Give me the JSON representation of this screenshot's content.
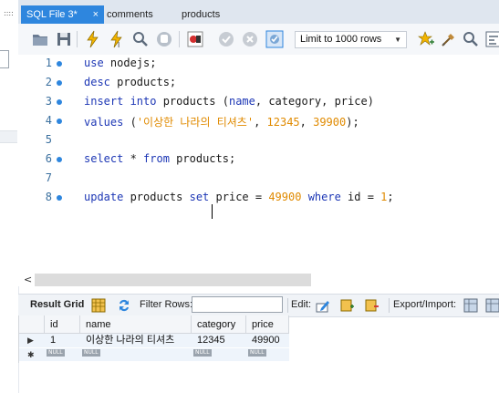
{
  "tabs": [
    {
      "label": "SQL File 3*",
      "close": "×",
      "active": true
    },
    {
      "label": "comments",
      "active": false
    },
    {
      "label": "products",
      "active": false
    }
  ],
  "left_panel": {
    "dots": "::::"
  },
  "toolbar": {
    "buttons": [
      "open-folder-icon",
      "save-icon",
      "execute-icon",
      "execute-current-icon",
      "explain-icon",
      "stop-icon",
      "toggle-icon",
      "commit-icon",
      "rollback-icon",
      "autocommit-icon",
      "bookmark-icon",
      "beautify-icon",
      "find-icon",
      "wrap-icon"
    ],
    "limit": {
      "selected": "Limit to 1000 rows",
      "caret": "▼"
    }
  },
  "editor": {
    "lines": [
      {
        "num": "1",
        "tokens": [
          {
            "t": "kw",
            "s": "use"
          },
          {
            "t": "pl",
            "s": " nodejs;"
          }
        ]
      },
      {
        "num": "2",
        "tokens": [
          {
            "t": "kw",
            "s": "desc"
          },
          {
            "t": "pl",
            "s": " products;"
          }
        ]
      },
      {
        "num": "3",
        "tokens": [
          {
            "t": "kw",
            "s": "insert into"
          },
          {
            "t": "pl",
            "s": " products ("
          },
          {
            "t": "kw",
            "s": "name"
          },
          {
            "t": "pl",
            "s": ", category, price)"
          }
        ]
      },
      {
        "num": "4",
        "tokens": [
          {
            "t": "kw",
            "s": "values"
          },
          {
            "t": "pl",
            "s": " ("
          },
          {
            "t": "str",
            "s": "'이상한 나라의 티셔츠'"
          },
          {
            "t": "pl",
            "s": ", "
          },
          {
            "t": "num",
            "s": "12345"
          },
          {
            "t": "pl",
            "s": ", "
          },
          {
            "t": "num",
            "s": "39900"
          },
          {
            "t": "pl",
            "s": ");"
          }
        ]
      },
      {
        "num": "5",
        "tokens": []
      },
      {
        "num": "6",
        "tokens": [
          {
            "t": "kw",
            "s": "select"
          },
          {
            "t": "pl",
            "s": " * "
          },
          {
            "t": "kw",
            "s": "from"
          },
          {
            "t": "pl",
            "s": " products;"
          }
        ]
      },
      {
        "num": "7",
        "tokens": []
      },
      {
        "num": "8",
        "tokens": [
          {
            "t": "kw",
            "s": "update"
          },
          {
            "t": "pl",
            "s": " products "
          },
          {
            "t": "kw",
            "s": "set"
          },
          {
            "t": "pl",
            "s": " price = "
          },
          {
            "t": "num",
            "s": "49900"
          },
          {
            "t": "pl",
            "s": " "
          },
          {
            "t": "kw",
            "s": "where"
          },
          {
            "t": "pl",
            "s": " id = "
          },
          {
            "t": "num",
            "s": "1"
          },
          {
            "t": "pl",
            "s": ";"
          }
        ]
      }
    ]
  },
  "hscroll": {
    "left_arrow": "<"
  },
  "result": {
    "result_grid_label": "Result Grid",
    "filter_label": "Filter Rows:",
    "edit_label": "Edit:",
    "export_label": "Export/Import:"
  },
  "grid": {
    "columns": [
      "id",
      "name",
      "category",
      "price"
    ],
    "row1": {
      "marker": "▶",
      "id": "1",
      "name": "이상한 나라의 티셔츠",
      "category": "12345",
      "price": "49900"
    },
    "row2": {
      "marker": "✱",
      "null": "NULL"
    }
  },
  "colors": {
    "accent": "#2e86de",
    "keyword": "#1d37b5",
    "literal": "#e08a00",
    "tabbar": "#dfe6ef"
  }
}
